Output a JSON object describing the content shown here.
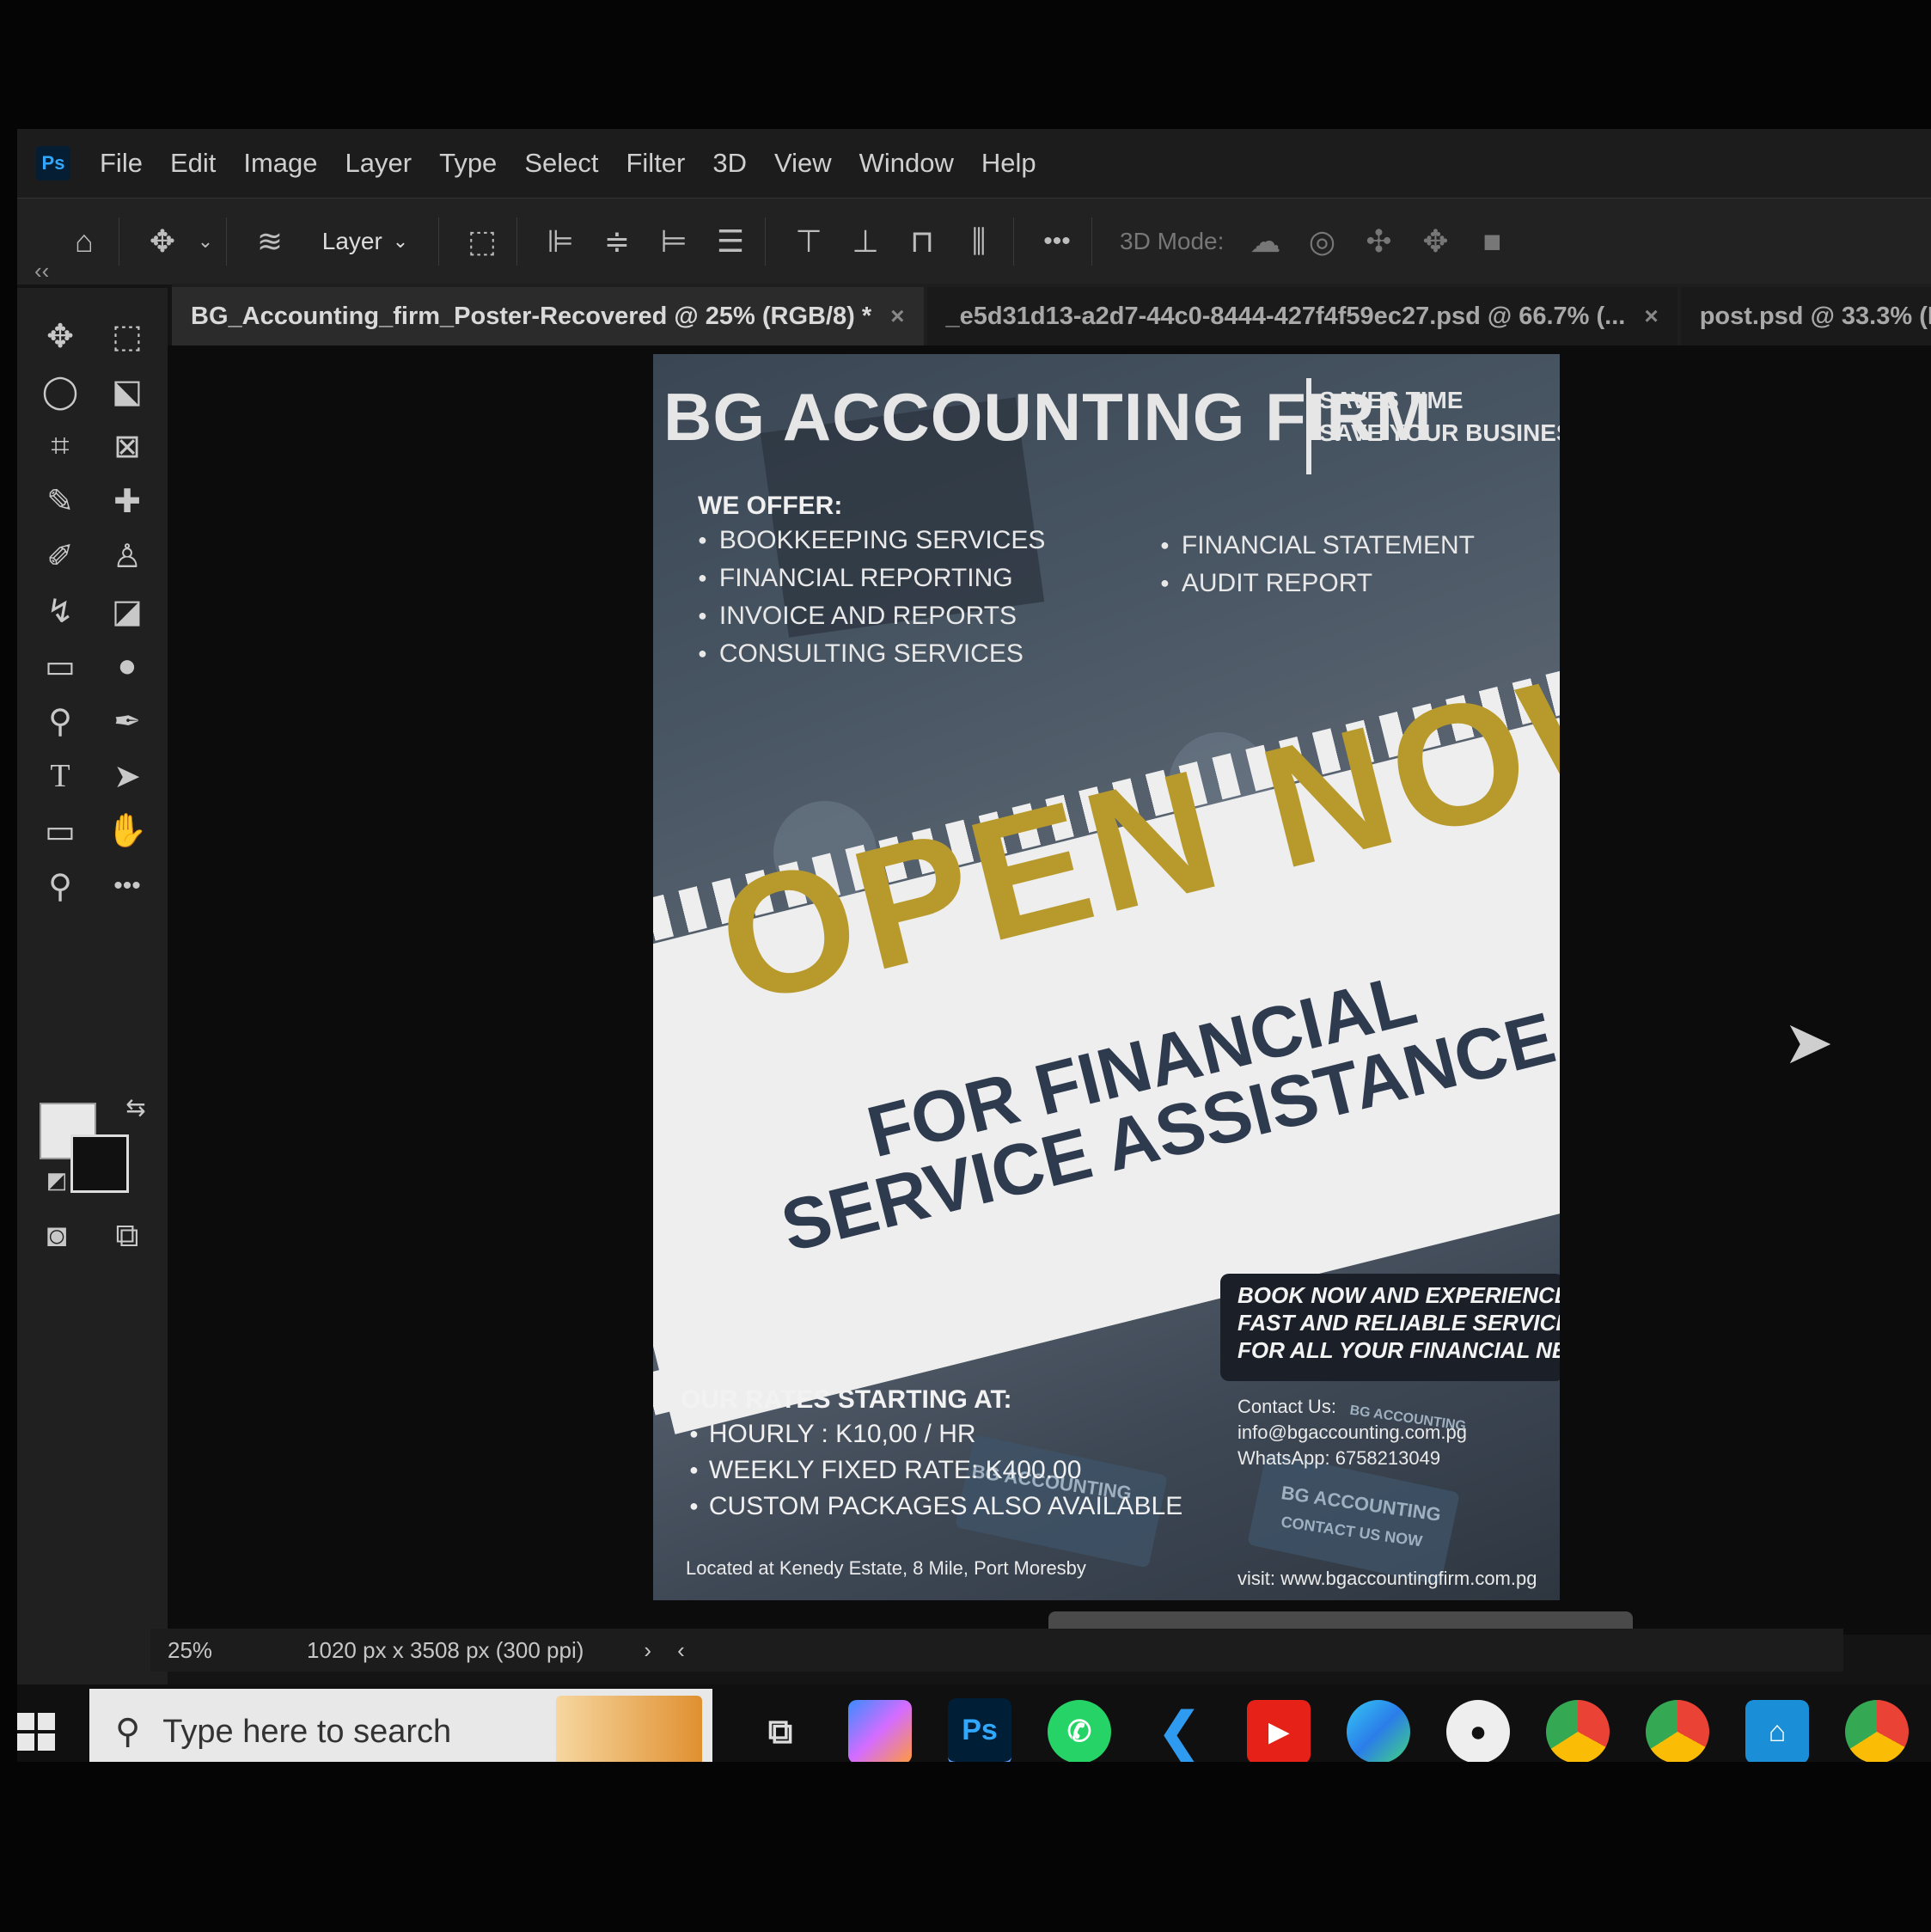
{
  "app": {
    "logo": "Ps"
  },
  "menu": [
    "File",
    "Edit",
    "Image",
    "Layer",
    "Type",
    "Select",
    "Filter",
    "3D",
    "View",
    "Window",
    "Help"
  ],
  "options": {
    "layer_dropdown": "Layer",
    "mode_label": "3D Mode:",
    "more": "•••"
  },
  "tabs": [
    {
      "label": "BG_Accounting_firm_Poster-Recovered @ 25% (RGB/8) *",
      "close": "×"
    },
    {
      "label": "_e5d31d13-a2d7-44c0-8444-427f4f59ec27.psd @ 66.7% (...",
      "close": "×"
    },
    {
      "label": "post.psd @ 33.3% (R",
      "close": ""
    }
  ],
  "collapse": "‹‹",
  "poster": {
    "title": "BG ACCOUNTING FIRM",
    "tagline1": "SAVES TIME",
    "tagline2": "SAVE YOUR BUSINESS",
    "offer_heading": "WE OFFER:",
    "services_left": [
      "BOOKKEEPING SERVICES",
      "FINANCIAL REPORTING",
      "INVOICE AND REPORTS",
      "CONSULTING SERVICES"
    ],
    "services_right": [
      "FINANCIAL STATEMENT",
      "AUDIT REPORT"
    ],
    "headline": "OPEN NOW",
    "sub1": "FOR FINANCIAL",
    "sub2": "SERVICE ASSISTANCE",
    "book_lines": [
      "BOOK NOW AND EXPERIENCE",
      "FAST AND RELIABLE SERVICE",
      "FOR ALL YOUR FINANCIAL NEEDS"
    ],
    "rates_heading": "OUR RATES STARTING AT:",
    "rates": [
      "HOURLY : K10,00 / HR",
      "WEEKLY FIXED RATE: K400.00",
      "CUSTOM PACKAGES ALSO AVAILABLE"
    ],
    "contact_heading": "Contact Us:",
    "email": "info@bgaccounting.com.pg",
    "whatsapp": "WhatsApp: 6758213049",
    "location": "Located at Kenedy Estate, 8 Mile, Port Moresby",
    "website": "visit: www.bgaccountingfirm.com.pg",
    "card_texts": [
      "BG ACCOUNTING",
      "BG ACCOUNTING",
      "CONTACT US NOW",
      "BG ACCOUNTING"
    ]
  },
  "status": {
    "zoom": "25%",
    "dimensions": "1020 px x 3508 px (300 ppi)",
    "arrow": "›",
    "scroll_left": "‹"
  },
  "taskbar": {
    "search_placeholder": "Type here to search",
    "ps_label": "Ps"
  }
}
